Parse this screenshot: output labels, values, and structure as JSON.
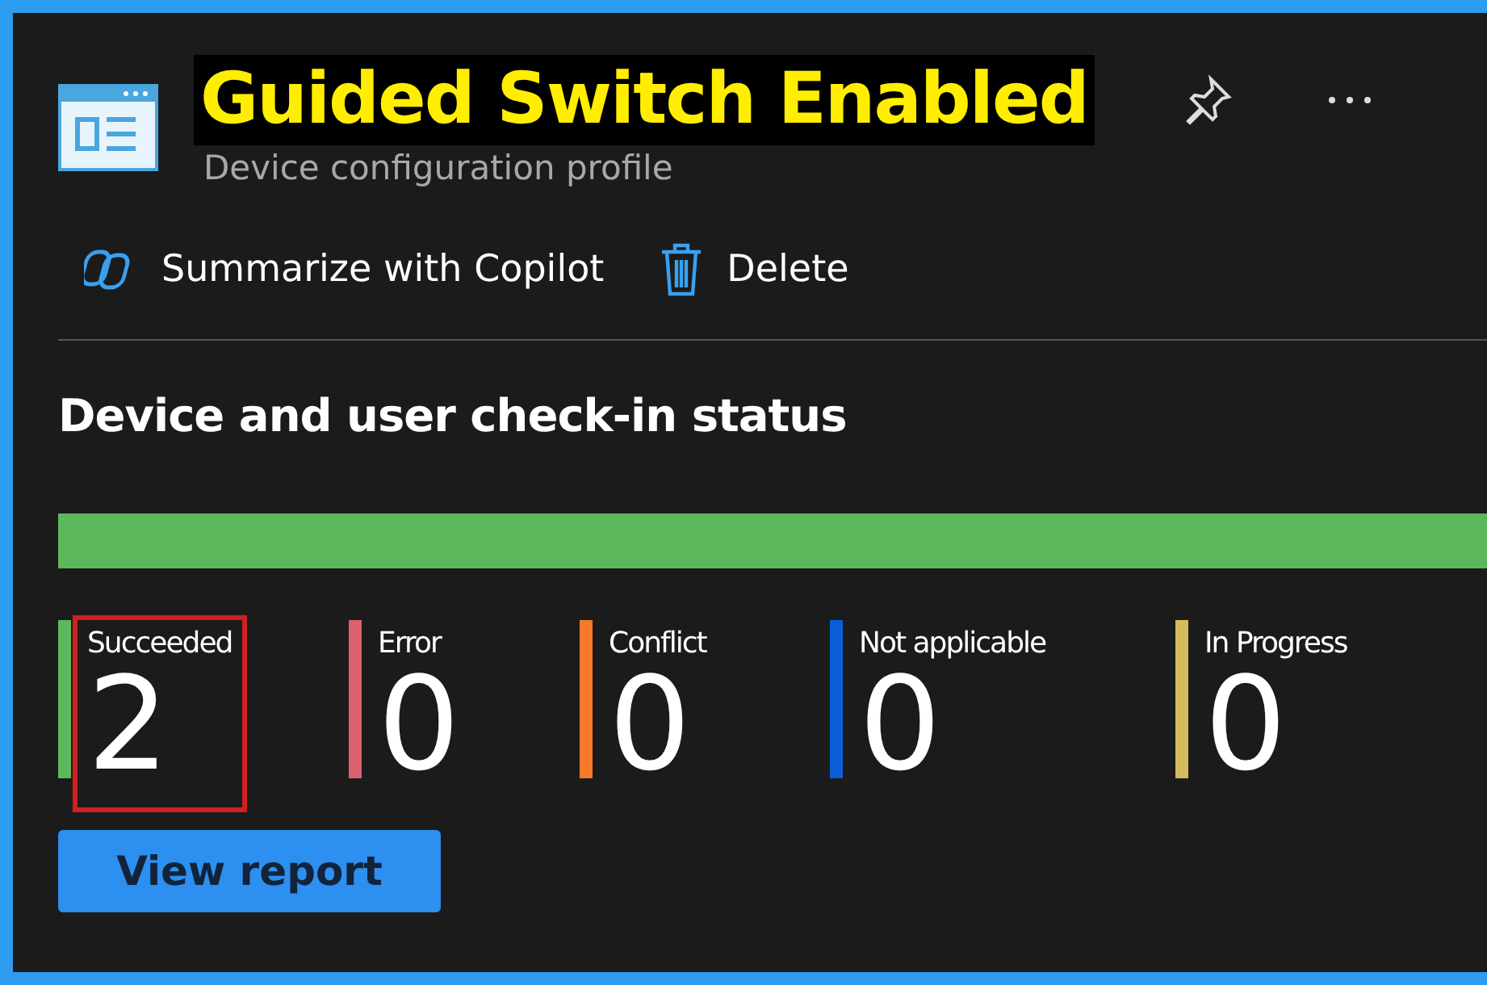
{
  "header": {
    "title": "Guided Switch Enabled",
    "title_highlighted": true,
    "subtitle": "Device configuration profile"
  },
  "toolbar": [
    {
      "kind": "copilot",
      "label": "Summarize with Copilot"
    },
    {
      "kind": "delete",
      "label": "Delete"
    }
  ],
  "section": {
    "title": "Device and user check-in status",
    "status_bar": [
      {
        "color": "#5cb85c",
        "level": 1
      }
    ],
    "stats": [
      {
        "label": "Succeeded",
        "value": "2",
        "color": "#5cb85c",
        "highlighted": true
      },
      {
        "label": "Error",
        "value": "0",
        "color": "#d9626e",
        "highlighted": false
      },
      {
        "label": "Conflict",
        "value": "0",
        "color": "#f7792a",
        "highlighted": false
      },
      {
        "label": "Not applicable",
        "value": "0",
        "color": "#0b5ed7",
        "highlighted": false
      },
      {
        "label": "In Progress",
        "value": "0",
        "color": "#d4bc5a",
        "highlighted": false
      }
    ],
    "button": "View report"
  }
}
